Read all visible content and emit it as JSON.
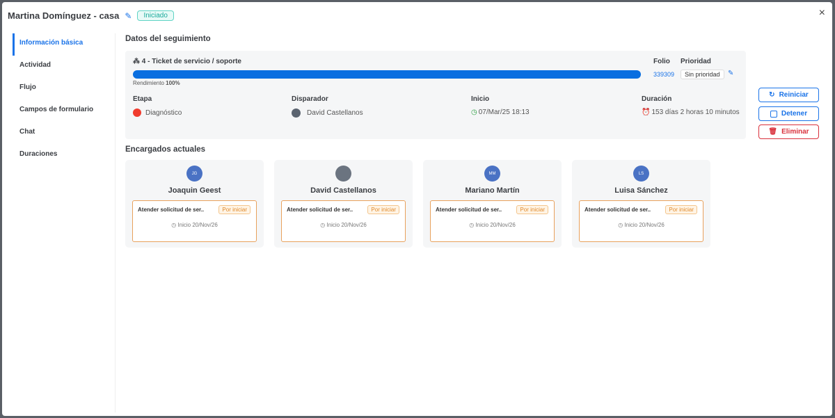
{
  "header": {
    "title": "Martina Domínguez - casa",
    "status": "Iniciado",
    "close": "×"
  },
  "sidebar": {
    "items": [
      {
        "label": "Información básica",
        "active": true
      },
      {
        "label": "Actividad"
      },
      {
        "label": "Flujo"
      },
      {
        "label": "Campos de formulario"
      },
      {
        "label": "Chat"
      },
      {
        "label": "Duraciones"
      }
    ]
  },
  "tracking": {
    "section_title": "Datos del seguimiento",
    "ticket": "4 - Ticket de servicio / soporte",
    "progress_percent": 100,
    "performance_label": "Rendimiento",
    "performance_value": "100%",
    "folio_label": "Folio",
    "folio": "339309",
    "priority_label": "Prioridad",
    "priority": "Sin prioridad",
    "stage_label": "Etapa",
    "stage": "Diagnóstico",
    "stage_color": "#f03c2e",
    "trigger_label": "Disparador",
    "trigger": "David Castellanos",
    "start_label": "Inicio",
    "start": "07/Mar/25 18:13",
    "duration_label": "Duración",
    "duration": "153 días 2 horas 10 minutos"
  },
  "actions": {
    "restart": "Reiniciar",
    "stop": "Detener",
    "delete": "Eliminar"
  },
  "assignees": {
    "title": "Encargados actuales",
    "items": [
      {
        "initials": "JG",
        "name": "Joaquin Geest",
        "task": "Atender solicitud de ser..",
        "status": "Por iniciar",
        "start": "Inicio 20/Nov/26"
      },
      {
        "initials": "",
        "name": "David Castellanos",
        "task": "Atender solicitud de ser..",
        "status": "Por iniciar",
        "start": "Inicio 20/Nov/26"
      },
      {
        "initials": "MM",
        "name": "Mariano Martín",
        "task": "Atender solicitud de ser..",
        "status": "Por iniciar",
        "start": "Inicio 20/Nov/26"
      },
      {
        "initials": "LS",
        "name": "Luisa Sánchez",
        "task": "Atender solicitud de ser..",
        "status": "Por iniciar",
        "start": "Inicio 20/Nov/26"
      }
    ]
  }
}
